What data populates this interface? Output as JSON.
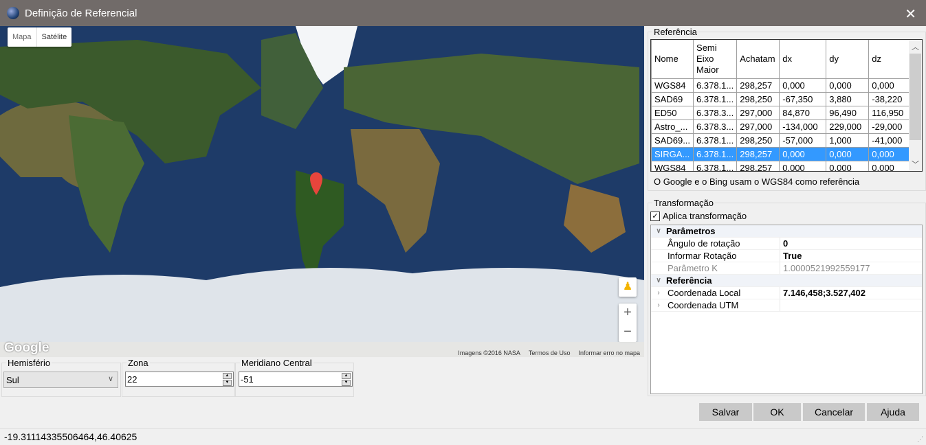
{
  "window": {
    "title": "Definição de Referencial",
    "close_icon": "close-icon"
  },
  "map": {
    "map_type_buttons": [
      "Mapa",
      "Satélite"
    ],
    "logo": "Google",
    "attribution": [
      "Imagens ©2016 NASA",
      "Termos de Uso",
      "Informar erro no mapa"
    ],
    "zoom_in": "+",
    "zoom_out": "−"
  },
  "hemisferio": {
    "label": "Hemisfério",
    "value": "Sul"
  },
  "zona": {
    "label": "Zona",
    "value": "22"
  },
  "meridiano": {
    "label": "Meridiano Central",
    "value": "-51"
  },
  "referencia": {
    "label": "Referência",
    "columns": [
      "Nome",
      "Semi Eixo Maior",
      "Achatam",
      "dx",
      "dy",
      "dz"
    ],
    "rows": [
      [
        "WGS84",
        "6.378.1...",
        "298,257",
        "0,000",
        "0,000",
        "0,000"
      ],
      [
        "SAD69",
        "6.378.1...",
        "298,250",
        "-67,350",
        "3,880",
        "-38,220"
      ],
      [
        "ED50",
        "6.378.3...",
        "297,000",
        "84,870",
        "96,490",
        "116,950"
      ],
      [
        "Astro_...",
        "6.378.3...",
        "297,000",
        "-134,000",
        "229,000",
        "-29,000"
      ],
      [
        "SAD69...",
        "6.378.1...",
        "298,250",
        "-57,000",
        "1,000",
        "-41,000"
      ],
      [
        "SIRGA...",
        "6.378.1...",
        "298,257",
        "0,000",
        "0,000",
        "0,000"
      ],
      [
        "WGS84",
        "6.378.1...",
        "298,257",
        "0,000",
        "0,000",
        "0,000"
      ]
    ],
    "selected_row": 5,
    "note": "O Google e o Bing usam o WGS84 como referência"
  },
  "transformacao": {
    "label": "Transformação",
    "checkbox_label": "Aplica transformação",
    "checked": true,
    "categories": [
      {
        "name": "Parâmetros",
        "props": [
          {
            "k": "Ângulo de rotação",
            "v": "0"
          },
          {
            "k": "Informar Rotação",
            "v": "True"
          },
          {
            "k": "Parâmetro K",
            "v": "1.0000521992559177"
          }
        ]
      },
      {
        "name": "Referência",
        "props": [
          {
            "k": "Coordenada Local",
            "v": "7.146,458;3.527,402"
          },
          {
            "k": "Coordenada UTM",
            "v": ""
          }
        ]
      }
    ]
  },
  "buttons": {
    "salvar": "Salvar",
    "ok": "OK",
    "cancelar": "Cancelar",
    "ajuda": "Ajuda"
  },
  "status": "-19.31114335506464,46.40625"
}
